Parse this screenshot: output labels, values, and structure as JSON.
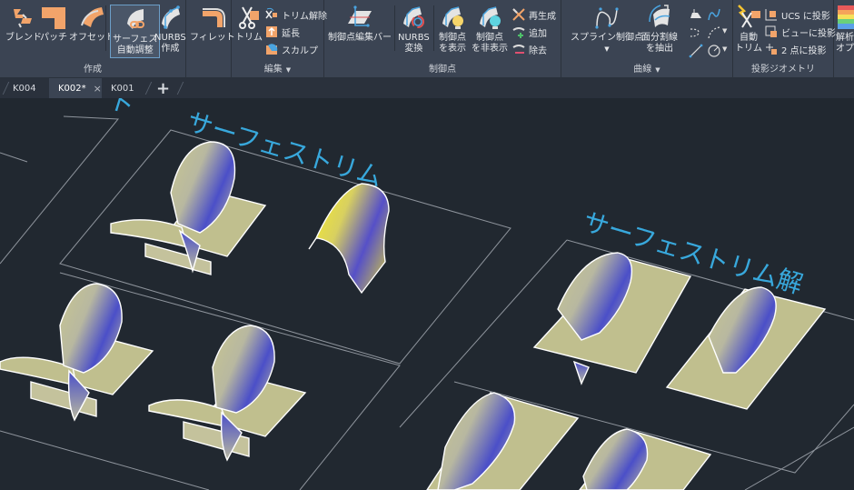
{
  "ribbon": {
    "panels": {
      "create": {
        "title": "作成",
        "buttons": {
          "blend": "ブレンド",
          "patch": "パッチ",
          "offset": "オフセット",
          "surface_auto_adjust_line1": "サーフェス",
          "surface_auto_adjust_line2": "自動調整",
          "nurbs_create_line1": "NURBS",
          "nurbs_create_line2": "作成"
        }
      },
      "fillet": {
        "label": "フィレット"
      },
      "edit": {
        "title": "編集",
        "buttons": {
          "trim": "トリム",
          "untrim": "トリム解除",
          "extend": "延長",
          "sculpt": "スカルプ"
        }
      },
      "control_points": {
        "title": "制御点",
        "buttons": {
          "cv_edit_bar": "制御点編集バー",
          "nurbs_convert_line1": "NURBS",
          "nurbs_convert_line2": "変換",
          "show_cv_line1": "制御点",
          "show_cv_line2": "を表示",
          "hide_cv_line1": "制御点",
          "hide_cv_line2": "を非表示",
          "rebuild": "再生成",
          "add": "追加",
          "remove": "除去"
        }
      },
      "curves": {
        "title": "曲線",
        "buttons": {
          "spline_cv": "スプライン制御点",
          "extract_isoline_line1": "面分割線",
          "extract_isoline_line2": "を抽出"
        }
      },
      "project_geometry": {
        "title": "投影ジオメトリ",
        "buttons": {
          "auto_trim_line1": "自動",
          "auto_trim_line2": "トリム",
          "project_ucs": "UCS に投影",
          "project_view": "ビューに投影",
          "project_2pt": "2 点に投影"
        }
      },
      "analysis": {
        "label_line1": "解析",
        "label_line2": "オプシ"
      }
    }
  },
  "tabs": [
    {
      "label": "K004",
      "active": false
    },
    {
      "label": "K002*",
      "active": true
    },
    {
      "label": "K001",
      "active": false
    }
  ],
  "new_tab_label": "+",
  "close_label": "×",
  "viewport": {
    "labels": {
      "surface_trim": "サーフェストリム",
      "surface_untrim": "サーフェストリム解",
      "partial": "ト"
    }
  },
  "colors": {
    "ribbon_bg": "#3b4453",
    "viewport_bg": "#212830",
    "label_text": "#38a8dc",
    "surface_khaki": "#c0bf8e",
    "surface_blue": "#3b3fcf",
    "surface_yellow": "#f5ea2c",
    "accent_orange": "#f4a261"
  }
}
